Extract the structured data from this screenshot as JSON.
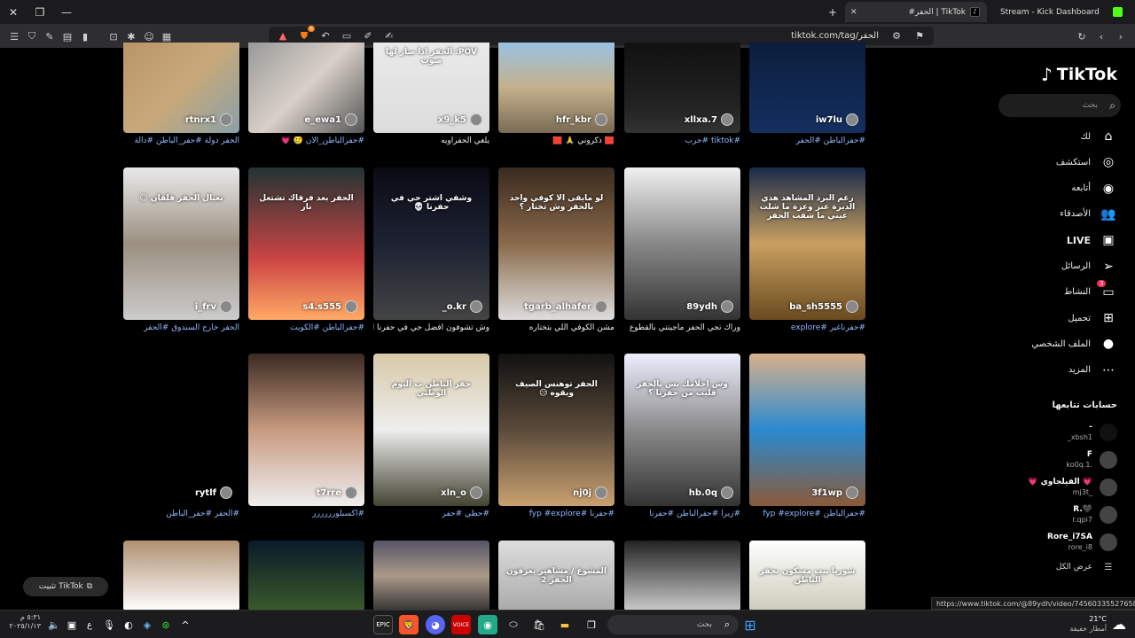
{
  "browser": {
    "tabs": [
      {
        "title": "Stream - Kick Dashboard"
      },
      {
        "title": "#الحفر | TikTok",
        "active": true
      }
    ],
    "url": "tiktok.com/tag/الحفر",
    "status_url": "https://www.tiktok.com/@89ydh/video/7456033552765848840",
    "ext_badge": "6"
  },
  "sidebar": {
    "logo": "TikTok",
    "search_placeholder": "بحث",
    "nav": [
      {
        "label": "لك",
        "icon": "home-icon"
      },
      {
        "label": "استكشف",
        "icon": "compass-icon"
      },
      {
        "label": "أتابعه",
        "icon": "following-icon"
      },
      {
        "label": "الأصدقاء",
        "icon": "friends-icon"
      },
      {
        "label": "LIVE",
        "icon": "live-icon"
      },
      {
        "label": "الرسائل",
        "icon": "send-icon"
      },
      {
        "label": "النشاط",
        "icon": "inbox-icon",
        "badge": "3"
      },
      {
        "label": "تحميل",
        "icon": "upload-icon"
      },
      {
        "label": "الملف الشخصي",
        "icon": "profile-icon"
      },
      {
        "label": "المزيد",
        "icon": "more-icon"
      }
    ],
    "following_title": "حسابات تتابعها",
    "following": [
      {
        "name": "-",
        "handle": "_xbsh1"
      },
      {
        "name": "F",
        "handle": "ko0q.1."
      },
      {
        "name": "💗 الفيلجاوي 💗",
        "handle": "mj3t_"
      },
      {
        "name": "R.🖤",
        "handle": "r.qpi7"
      },
      {
        "name": "Rore_i7SA",
        "handle": "rore_i8"
      }
    ],
    "see_all": "عرض الكل"
  },
  "videos": [
    {
      "user": "rtnrx1",
      "caption": "الحفر دولة #حفر_الباطن #دالة",
      "overlay": ""
    },
    {
      "user": "e_ewa1",
      "caption": "#حفرالباطن_الان 🥲 💗",
      "overlay": ""
    },
    {
      "user": "x9_k5",
      "caption": "يلغي الحفراويه",
      "overlay": "POV: الحفر اذا صار لها صوت"
    },
    {
      "user": "hfr_kbr",
      "caption": "🟥 ذكروني 🙏 🟥",
      "overlay": ""
    },
    {
      "user": "xllxa.7",
      "caption": "#tiktok #حرب",
      "overlay": ""
    },
    {
      "user": "iw7lu",
      "caption": "#حفرالباطن #الحفر",
      "overlay": ""
    },
    {
      "user": "i_frv",
      "caption": "الحفر خارج السندوق #الحفر",
      "overlay": "يعيال الحفر قلقان 😐"
    },
    {
      "user": "s4.s555",
      "caption": "#حفرالباطن #الكويت",
      "overlay": "الحفر بعد فرقاك تشتعل نار"
    },
    {
      "user": "_o.kr",
      "caption": "وش تشوفون أفضل حي في حفرنا أنا",
      "overlay": "وشفي اشتر حي في حفرنا 💀"
    },
    {
      "user": "tgarb_alhafer",
      "caption": "مشن الكوفي اللي بتختاره",
      "overlay": "لو مابقى الا كوفي واحد بالحفر وش تختار ؟"
    },
    {
      "user": "89ydh",
      "caption": "وراك تجي الحفر ماجيتني بالقطوع",
      "overlay": ""
    },
    {
      "user": "ba_sh5555",
      "caption": "#حفرناغير #explore",
      "overlay": "رغم البرد المشاهد هذي الديرة عنز وعزة ما شلت عيني ما شفت الحفر"
    },
    {
      "user": "rytlf",
      "caption": "#الحفر #حفر_الباطن",
      "overlay": ""
    },
    {
      "user": "t7rre",
      "caption": "#اكسبلورررررر",
      "overlay": ""
    },
    {
      "user": "xln_o",
      "caption": "#حظي #حفر",
      "overlay": "حفر الباطن ب اليوم الوطني"
    },
    {
      "user": "nj0j",
      "caption": "#حفرنا #fyp #explore",
      "overlay": "الحفر توهنس الصيف وبقوه 😥"
    },
    {
      "user": "hb.0q",
      "caption": "#زيرا #حفرالباطن #حفرنا",
      "overlay": "وش احلامك بس بالحفر قليت من حفرنا ؟"
    },
    {
      "user": "3f1wp",
      "caption": "#حفرالباطن #fyp #explore",
      "overlay": ""
    },
    {
      "user": "",
      "caption": "",
      "overlay": ""
    },
    {
      "user": "",
      "caption": "",
      "overlay": ""
    },
    {
      "user": "",
      "caption": "",
      "overlay": ""
    },
    {
      "user": "",
      "caption": "",
      "overlay": "المشوع / مشاهير يعرفون الحفر 2"
    },
    {
      "user": "",
      "caption": "",
      "overlay": ""
    },
    {
      "user": "",
      "caption": "",
      "overlay": "شوربا بيت مسكون بحفر الباطن"
    }
  ],
  "pin_button": "تثبيت TikTok",
  "taskbar": {
    "search_placeholder": "بحث",
    "time": "٥:٣١ م",
    "date": "٢٠٢٥/١/١٣",
    "weather_temp": "21°C",
    "weather_desc": "أمطار خفيفة",
    "lang": "ع"
  },
  "colors": {
    "accent": "#fe2c55",
    "hashtag": "#8fb8ff",
    "background": "#000000"
  }
}
